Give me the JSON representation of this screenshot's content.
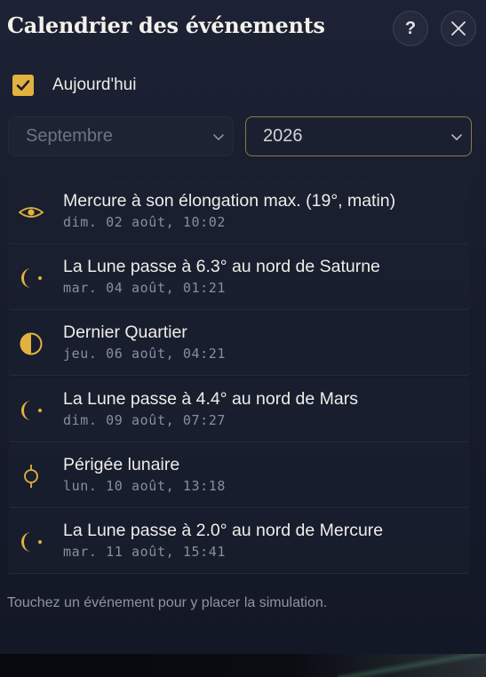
{
  "header": {
    "title": "Calendrier des événements",
    "help_label": "?"
  },
  "today": {
    "label": "Aujourd'hui",
    "checked": true
  },
  "filters": {
    "month": {
      "selected": "Septembre"
    },
    "year": {
      "selected": "2026"
    }
  },
  "events": [
    {
      "icon": "eye-icon",
      "title": "Mercure à son élongation max. (19°, matin)",
      "date": "dim. 02 août, 10:02"
    },
    {
      "icon": "moon-conjunction-icon",
      "title": "La Lune passe à 6.3° au nord de Saturne",
      "date": "mar. 04 août, 01:21"
    },
    {
      "icon": "last-quarter-icon",
      "title": "Dernier Quartier",
      "date": "jeu. 06 août, 04:21"
    },
    {
      "icon": "moon-conjunction-icon",
      "title": "La Lune passe à 4.4° au nord de Mars",
      "date": "dim. 09 août, 07:27"
    },
    {
      "icon": "perigee-icon",
      "title": "Périgée lunaire",
      "date": "lun. 10 août, 13:18"
    },
    {
      "icon": "moon-conjunction-icon",
      "title": "La Lune passe à 2.0° au nord de Mercure",
      "date": "mar. 11 août, 15:41"
    }
  ],
  "hint": "Touchez un événement pour y placer la simulation.",
  "colors": {
    "accent": "#e3b13f",
    "panel_bg": "#1a1f2e",
    "text": "#eeede9",
    "muted": "#8a8e9b"
  }
}
